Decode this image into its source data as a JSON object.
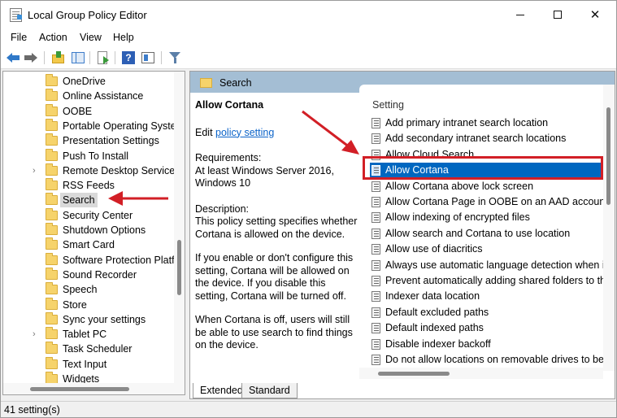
{
  "window": {
    "title": "Local Group Policy Editor",
    "minimize_glyph": "",
    "maximize_glyph": "",
    "close_glyph": "✕"
  },
  "menu": [
    "File",
    "Action",
    "View",
    "Help"
  ],
  "toolbar_icons": [
    "back-arrow-icon",
    "forward-arrow-icon",
    "folder-up-icon",
    "show-hide-console-tree-icon",
    "export-list-icon",
    "help-icon",
    "extended-view-icon",
    "filter-icon"
  ],
  "tree": {
    "items": [
      {
        "label": "OneDrive",
        "expandable": false
      },
      {
        "label": "Online Assistance",
        "expandable": false
      },
      {
        "label": "OOBE",
        "expandable": false
      },
      {
        "label": "Portable Operating Syste",
        "expandable": false
      },
      {
        "label": "Presentation Settings",
        "expandable": false
      },
      {
        "label": "Push To Install",
        "expandable": false
      },
      {
        "label": "Remote Desktop Services",
        "expandable": true
      },
      {
        "label": "RSS Feeds",
        "expandable": false
      },
      {
        "label": "Search",
        "expandable": false,
        "selected": true
      },
      {
        "label": "Security Center",
        "expandable": false
      },
      {
        "label": "Shutdown Options",
        "expandable": false
      },
      {
        "label": "Smart Card",
        "expandable": false
      },
      {
        "label": "Software Protection Platfo",
        "expandable": false
      },
      {
        "label": "Sound Recorder",
        "expandable": false
      },
      {
        "label": "Speech",
        "expandable": false
      },
      {
        "label": "Store",
        "expandable": false
      },
      {
        "label": "Sync your settings",
        "expandable": false
      },
      {
        "label": "Tablet PC",
        "expandable": true
      },
      {
        "label": "Task Scheduler",
        "expandable": false
      },
      {
        "label": "Text Input",
        "expandable": false
      },
      {
        "label": "Widgets",
        "expandable": false
      }
    ],
    "chevron_glyph": "›"
  },
  "right": {
    "header": "Search",
    "policy_title": "Allow Cortana",
    "edit_prefix": "Edit ",
    "edit_link": "policy setting",
    "requirements_label": "Requirements:",
    "requirements_text": "At least Windows Server 2016, Windows 10",
    "description_label": "Description:",
    "description_text": "This policy setting specifies whether Cortana is allowed on the device.",
    "paragraph2": "If you enable or don't configure this setting, Cortana will be allowed on the device. If you disable this setting, Cortana will be turned off.",
    "paragraph3": "When Cortana is off, users will still be able to use search to find things on the device.",
    "column_header": "Setting",
    "settings": [
      {
        "label": "Add primary intranet search location"
      },
      {
        "label": "Add secondary intranet search locations"
      },
      {
        "label": "Allow Cloud Search"
      },
      {
        "label": "Allow Cortana",
        "selected": true
      },
      {
        "label": "Allow Cortana above lock screen"
      },
      {
        "label": "Allow Cortana Page in OOBE on an AAD account"
      },
      {
        "label": "Allow indexing of encrypted files"
      },
      {
        "label": "Allow search and Cortana to use location"
      },
      {
        "label": "Allow use of diacritics"
      },
      {
        "label": "Always use automatic language detection when in"
      },
      {
        "label": "Prevent automatically adding shared folders to the"
      },
      {
        "label": "Indexer data location"
      },
      {
        "label": "Default excluded paths"
      },
      {
        "label": "Default indexed paths"
      },
      {
        "label": "Disable indexer backoff"
      },
      {
        "label": "Do not allow locations on removable drives to be a"
      }
    ]
  },
  "tabs": [
    "Extended",
    "Standard"
  ],
  "status": "41 setting(s)",
  "colors": {
    "selection": "#0067c0",
    "header_band": "#a4bed4",
    "annotation": "#d21f26",
    "link": "#0b63c9"
  }
}
